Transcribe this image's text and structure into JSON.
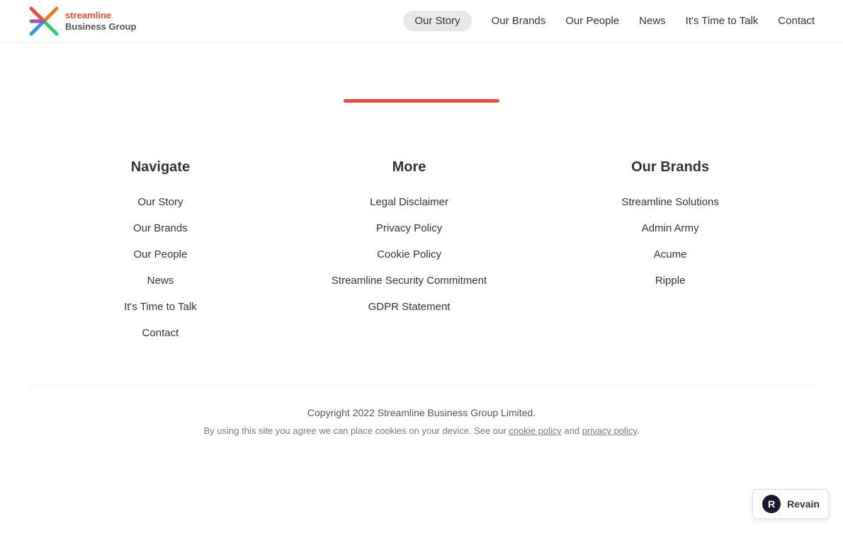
{
  "nav": {
    "logo": {
      "line1": "streamline",
      "line2": "Business Group"
    },
    "links": [
      {
        "id": "our-story",
        "label": "Our Story",
        "active": true
      },
      {
        "id": "our-brands",
        "label": "Our Brands",
        "active": false
      },
      {
        "id": "our-people",
        "label": "Our People",
        "active": false
      },
      {
        "id": "news",
        "label": "News",
        "active": false
      },
      {
        "id": "its-time-to-talk",
        "label": "It's Time to Talk",
        "active": false
      },
      {
        "id": "contact",
        "label": "Contact",
        "active": false
      }
    ]
  },
  "footer": {
    "columns": [
      {
        "id": "navigate",
        "title": "Navigate",
        "links": [
          {
            "label": "Our Story",
            "href": "#"
          },
          {
            "label": "Our Brands",
            "href": "#"
          },
          {
            "label": "Our People",
            "href": "#"
          },
          {
            "label": "News",
            "href": "#"
          },
          {
            "label": "It's Time to Talk",
            "href": "#"
          },
          {
            "label": "Contact",
            "href": "#"
          }
        ]
      },
      {
        "id": "more",
        "title": "More",
        "links": [
          {
            "label": "Legal Disclaimer",
            "href": "#"
          },
          {
            "label": "Privacy Policy",
            "href": "#"
          },
          {
            "label": "Cookie Policy",
            "href": "#"
          },
          {
            "label": "Streamline Security Commitment",
            "href": "#"
          },
          {
            "label": "GDPR Statement",
            "href": "#"
          }
        ]
      },
      {
        "id": "our-brands",
        "title": "Our Brands",
        "links": [
          {
            "label": "Streamline Solutions",
            "href": "#"
          },
          {
            "label": "Admin Army",
            "href": "#"
          },
          {
            "label": "Acume",
            "href": "#"
          },
          {
            "label": "Ripple",
            "href": "#"
          }
        ]
      }
    ],
    "copyright": "Copyright 2022 Streamline Business Group Limited.",
    "cookie_notice": "By using this site you agree we can place cookies on your device. See our cookie policy and privacy policy.",
    "cookie_policy_label": "cookie policy",
    "privacy_policy_label": "privacy policy"
  },
  "revain": {
    "label": "Revain"
  },
  "colors": {
    "accent": "#e74c3c",
    "nav_active_bg": "#e8e8e8"
  }
}
